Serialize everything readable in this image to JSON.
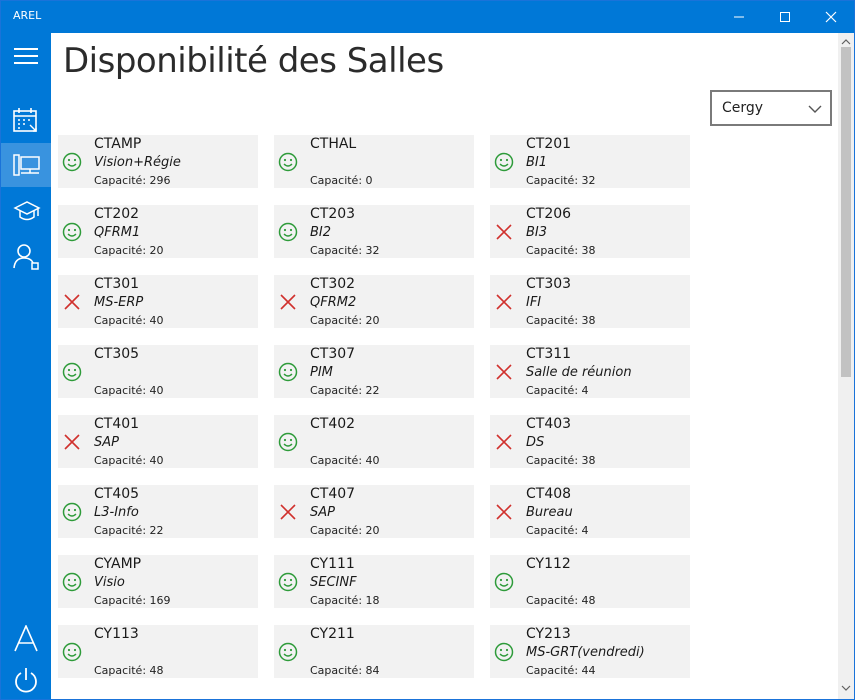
{
  "window": {
    "title": "AREL"
  },
  "page": {
    "title": "Disponibilité des Salles"
  },
  "campus_select": {
    "value": "Cergy"
  },
  "sidebar": {
    "items": [
      {
        "icon": "menu-icon"
      },
      {
        "icon": "calendar-icon"
      },
      {
        "icon": "rooms-icon",
        "selected": true
      },
      {
        "icon": "graduation-cap-icon"
      },
      {
        "icon": "user-icon"
      },
      {
        "icon": "arel-logo-icon"
      },
      {
        "icon": "power-icon"
      }
    ]
  },
  "colors": {
    "accent": "#0078d7",
    "available": "#2e9b3a",
    "busy": "#d0312d",
    "tile": "#f2f2f2"
  },
  "rooms": [
    {
      "name": "CTAMP",
      "course": "Vision+Régie",
      "capacity": "Capacité: 296",
      "available": true
    },
    {
      "name": "CTHAL",
      "course": "",
      "capacity": "Capacité: 0",
      "available": true
    },
    {
      "name": "CT201",
      "course": "BI1",
      "capacity": "Capacité: 32",
      "available": true
    },
    {
      "name": "CT202",
      "course": "QFRM1",
      "capacity": "Capacité: 20",
      "available": true
    },
    {
      "name": "CT203",
      "course": "BI2",
      "capacity": "Capacité: 32",
      "available": true
    },
    {
      "name": "CT206",
      "course": "BI3",
      "capacity": "Capacité: 38",
      "available": false
    },
    {
      "name": "CT301",
      "course": "MS-ERP",
      "capacity": "Capacité: 40",
      "available": false
    },
    {
      "name": "CT302",
      "course": "QFRM2",
      "capacity": "Capacité: 20",
      "available": false
    },
    {
      "name": "CT303",
      "course": "IFI",
      "capacity": "Capacité: 38",
      "available": false
    },
    {
      "name": "CT305",
      "course": "",
      "capacity": "Capacité: 40",
      "available": true
    },
    {
      "name": "CT307",
      "course": "PIM",
      "capacity": "Capacité: 22",
      "available": true
    },
    {
      "name": "CT311",
      "course": "Salle de réunion",
      "capacity": "Capacité: 4",
      "available": false
    },
    {
      "name": "CT401",
      "course": "SAP",
      "capacity": "Capacité: 40",
      "available": false
    },
    {
      "name": "CT402",
      "course": "",
      "capacity": "Capacité: 40",
      "available": true
    },
    {
      "name": "CT403",
      "course": "DS",
      "capacity": "Capacité: 38",
      "available": false
    },
    {
      "name": "CT405",
      "course": "L3-Info",
      "capacity": "Capacité: 22",
      "available": true
    },
    {
      "name": "CT407",
      "course": "SAP",
      "capacity": "Capacité: 20",
      "available": false
    },
    {
      "name": "CT408",
      "course": "Bureau",
      "capacity": "Capacité: 4",
      "available": false
    },
    {
      "name": "CYAMP",
      "course": "Visio",
      "capacity": "Capacité: 169",
      "available": true
    },
    {
      "name": "CY111",
      "course": "SECINF",
      "capacity": "Capacité: 18",
      "available": true
    },
    {
      "name": "CY112",
      "course": "",
      "capacity": "Capacité: 48",
      "available": true
    },
    {
      "name": "CY113",
      "course": "",
      "capacity": "Capacité: 48",
      "available": true
    },
    {
      "name": "CY211",
      "course": "",
      "capacity": "Capacité: 84",
      "available": true
    },
    {
      "name": "CY213",
      "course": "MS-GRT(vendredi)",
      "capacity": "Capacité: 44",
      "available": true
    }
  ]
}
